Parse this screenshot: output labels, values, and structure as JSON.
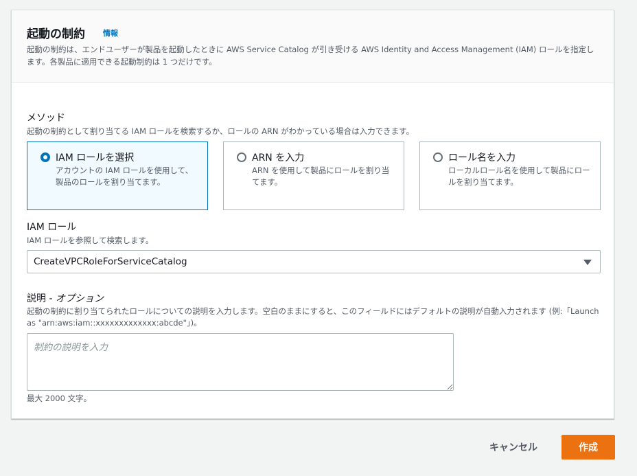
{
  "header": {
    "title": "起動の制約",
    "info_link": "情報",
    "description": "起動の制約は、エンドユーザーが製品を起動したときに AWS Service Catalog が引き受ける AWS Identity and Access Management (IAM) ロールを指定します。各製品に適用できる起動制約は 1 つだけです。"
  },
  "method": {
    "label": "メソッド",
    "description": "起動の制約として割り当てる IAM ロールを検索するか、ロールの ARN がわかっている場合は入力できます。",
    "selected": "iam-role",
    "options": [
      {
        "id": "iam-role",
        "title": "IAM ロールを選択",
        "description": "アカウントの IAM ロールを使用して、製品のロールを割り当てます。"
      },
      {
        "id": "arn",
        "title": "ARN を入力",
        "description": "ARN を使用して製品にロールを割り当てます。"
      },
      {
        "id": "role-name",
        "title": "ロール名を入力",
        "description": "ローカルロール名を使用して製品にロールを割り当てます。"
      }
    ]
  },
  "iam_role": {
    "label": "IAM ロール",
    "description": "IAM ロールを参照して検索します。",
    "value": "CreateVPCRoleForServiceCatalog"
  },
  "description_field": {
    "label_main": "説明 - ",
    "label_optional": "オプション",
    "description": "起動の制約に割り当てられたロールについての説明を入力します。空白のままにすると、このフィールドにはデフォルトの説明が自動入力されます (例:「Launch as \"arn:aws:iam::xxxxxxxxxxxxx:abcde\"」)。",
    "placeholder": "制約の説明を入力",
    "value": "",
    "constraint": "最大 2000 文字。"
  },
  "footer": {
    "cancel_label": "キャンセル",
    "create_label": "作成"
  },
  "colors": {
    "accent": "#0073bb",
    "primary_button": "#ec7211",
    "selected_tile_bg": "#f1faff"
  }
}
